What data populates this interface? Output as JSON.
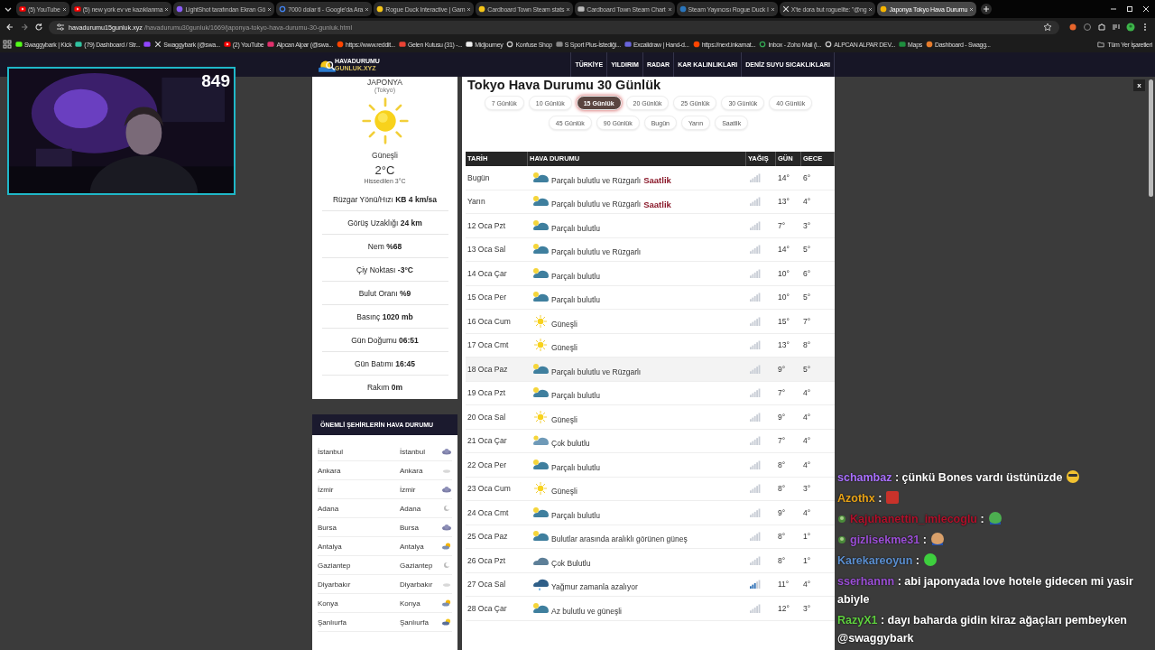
{
  "browser": {
    "tabs": [
      {
        "title": "(5) YouTube",
        "kind": "youtube",
        "selected": false
      },
      {
        "title": "(5) new york ev ve kazıklanma",
        "kind": "youtube",
        "selected": false
      },
      {
        "title": "LightShot tarafından Ekran Gö",
        "kind": "feather",
        "selected": false
      },
      {
        "title": "7000 dolar tl - Google'da Ara",
        "kind": "google",
        "selected": false
      },
      {
        "title": "Rogue Duck Interactive | Gam",
        "kind": "duck",
        "selected": false
      },
      {
        "title": "Cardboard Town Steam stats",
        "kind": "duck",
        "selected": false
      },
      {
        "title": "Cardboard Town Steam Chart",
        "kind": "database",
        "selected": false
      },
      {
        "title": "Steam Yayıncısı Rogue Duck I",
        "kind": "steam",
        "selected": false
      },
      {
        "title": "X'te dora but roguelite: \"@ng",
        "kind": "x",
        "selected": false
      },
      {
        "title": "Japonya Tokyo Hava Durumu",
        "kind": "sun",
        "selected": true
      }
    ],
    "address": {
      "host": "havadurumu15gunluk.xyz",
      "path": "/havadurumu30gunluk/1669/japonya-tokyo-hava-durumu-30-gunluk.html"
    },
    "bookmarks": [
      {
        "label": "Swaggybark | Kick",
        "kind": "kick"
      },
      {
        "label": "(79) Dashboard / Str...",
        "kind": "streamlabs"
      },
      {
        "kind": "twitch"
      },
      {
        "label": "Swaggybark (@swa...",
        "kind": "x"
      },
      {
        "label": "(2) YouTube",
        "kind": "youtube"
      },
      {
        "label": "Alpcan Alpar (@swa...",
        "kind": "instagram"
      },
      {
        "label": "https://www.reddit...",
        "kind": "reddit"
      },
      {
        "label": "Gelen Kutusu (31) -...",
        "kind": "gmail"
      },
      {
        "label": "Midjourney",
        "kind": "page"
      },
      {
        "label": "Konfuse Shop",
        "kind": "globe"
      },
      {
        "label": "S Sport Plus-İstediği...",
        "kind": "sport"
      },
      {
        "label": "Excalidraw | Hand-d...",
        "kind": "excalidraw"
      },
      {
        "label": "https://next.inkarnat...",
        "kind": "reddit"
      },
      {
        "label": "Inbox - Zoho Mail (i...",
        "kind": "chrome"
      },
      {
        "label": "ALPCAN ALPAR DEV...",
        "kind": "globe"
      },
      {
        "label": "Maps",
        "kind": "maps"
      },
      {
        "label": "Dashboard - Swagg...",
        "kind": "dashboard"
      }
    ],
    "all_bookmarks": "Tüm Yer İşaretleri"
  },
  "site": {
    "logo": [
      "HAVADURUMU",
      "GUNLUK.XYZ"
    ],
    "nav": [
      "TÜRKİYE",
      "YILDIRIM",
      "RADAR",
      "KAR KALINLIKLARI",
      "DENİZ SUYU SICAKLIKLARI"
    ]
  },
  "current": {
    "country": "JAPONYA",
    "city": "(Tokyo)",
    "condition": "Güneşli",
    "temperature": "2°C",
    "feels_like": "Hissedilen 3°C",
    "details": [
      "Rüzgar Yönü/Hızı **KB 4 km/sa**",
      "Görüş Uzaklığı **24 km**",
      "Nem **%68**",
      "Çiy Noktası **-3°C**",
      "Bulut Oranı **%9**",
      "Basınç **1020 mb**",
      "Gün Doğumu **06:51**",
      "Gün Batımı **16:45**",
      "Rakım **0m**"
    ]
  },
  "cities": {
    "title": "ÖNEMLİ ŞEHİRLERİN HAVA DURUMU",
    "rows": [
      {
        "left": "İstanbul",
        "right": "İstanbul",
        "kind": "cloud"
      },
      {
        "left": "Ankara",
        "right": "Ankara",
        "kind": "fog"
      },
      {
        "left": "İzmir",
        "right": "İzmir",
        "kind": "cloud"
      },
      {
        "left": "Adana",
        "right": "Adana",
        "kind": "moon"
      },
      {
        "left": "Bursa",
        "right": "Bursa",
        "kind": "cloud"
      },
      {
        "left": "Antalya",
        "right": "Antalya",
        "kind": "sun-cloud"
      },
      {
        "left": "Gaziantep",
        "right": "Gaziantep",
        "kind": "moon"
      },
      {
        "left": "Diyarbakır",
        "right": "Diyarbakır",
        "kind": "fog"
      },
      {
        "left": "Konya",
        "right": "Konya",
        "kind": "sun-cloud"
      },
      {
        "left": "Şanlıurfa",
        "right": "Şanlıurfa",
        "kind": "moon-cloud"
      }
    ]
  },
  "forecast": {
    "title": "Tokyo Hava Durumu 30 Günlük",
    "ranges": [
      {
        "label": "7 Günlük",
        "selected": false
      },
      {
        "label": "10 Günlük",
        "selected": false
      },
      {
        "label": "15 Günlük",
        "selected": true
      },
      {
        "label": "20 Günlük",
        "selected": false
      },
      {
        "label": "25 Günlük",
        "selected": false
      },
      {
        "label": "30 Günlük",
        "selected": false
      },
      {
        "label": "40 Günlük",
        "selected": false
      },
      {
        "label": "45 Günlük",
        "selected": false
      },
      {
        "label": "90 Günlük",
        "selected": false
      },
      {
        "label": "Bugün",
        "selected": false
      },
      {
        "label": "Yarın",
        "selected": false
      },
      {
        "label": "Saatlik",
        "selected": false
      }
    ],
    "columns": [
      "TARİH",
      "HAVA DURUMU",
      "YAĞIŞ",
      "GÜN",
      "GECE"
    ],
    "rows": [
      {
        "date": "Bugün",
        "kind": "partly",
        "description": "Parçalı bulutlu ve Rüzgarlı",
        "link": "Saatlik",
        "rain": false,
        "day": "14°",
        "night": "6°",
        "hovered": false
      },
      {
        "date": "Yarın",
        "kind": "partly",
        "description": "Parçalı bulutlu ve Rüzgarlı",
        "link": "Saatlik",
        "rain": false,
        "day": "13°",
        "night": "4°",
        "hovered": false
      },
      {
        "date": "12 Oca Pzt",
        "kind": "partly",
        "description": "Parçalı bulutlu",
        "rain": false,
        "day": "7°",
        "night": "3°",
        "hovered": false
      },
      {
        "date": "13 Oca Sal",
        "kind": "partly",
        "description": "Parçalı bulutlu ve Rüzgarlı",
        "rain": false,
        "day": "14°",
        "night": "5°",
        "hovered": false
      },
      {
        "date": "14 Oca Çar",
        "kind": "partly",
        "description": "Parçalı bulutlu",
        "rain": false,
        "day": "10°",
        "night": "6°",
        "hovered": false
      },
      {
        "date": "15 Oca Per",
        "kind": "partly",
        "description": "Parçalı bulutlu",
        "rain": false,
        "day": "10°",
        "night": "5°",
        "hovered": false
      },
      {
        "date": "16 Oca Cum",
        "kind": "sun",
        "description": "Güneşli",
        "rain": false,
        "day": "15°",
        "night": "7°",
        "hovered": false
      },
      {
        "date": "17 Oca Cmt",
        "kind": "sun",
        "description": "Güneşli",
        "rain": false,
        "day": "13°",
        "night": "8°",
        "hovered": false
      },
      {
        "date": "18 Oca Paz",
        "kind": "partly",
        "description": "Parçalı bulutlu ve Rüzgarlı",
        "rain": false,
        "day": "9°",
        "night": "5°",
        "hovered": true
      },
      {
        "date": "19 Oca Pzt",
        "kind": "partly",
        "description": "Parçalı bulutlu",
        "rain": false,
        "day": "7°",
        "night": "4°",
        "hovered": false
      },
      {
        "date": "20 Oca Sal",
        "kind": "sun",
        "description": "Güneşli",
        "rain": false,
        "day": "9°",
        "night": "4°",
        "hovered": false
      },
      {
        "date": "21 Oca Çar",
        "kind": "cloudy",
        "description": "Çok bulutlu",
        "rain": false,
        "day": "7°",
        "night": "4°",
        "hovered": false
      },
      {
        "date": "22 Oca Per",
        "kind": "partly",
        "description": "Parçalı bulutlu",
        "rain": false,
        "day": "8°",
        "night": "4°",
        "hovered": false
      },
      {
        "date": "23 Oca Cum",
        "kind": "sun",
        "description": "Güneşli",
        "rain": false,
        "day": "8°",
        "night": "3°",
        "hovered": false
      },
      {
        "date": "24 Oca Cmt",
        "kind": "partly",
        "description": "Parçalı bulutlu",
        "rain": false,
        "day": "9°",
        "night": "4°",
        "hovered": false
      },
      {
        "date": "25 Oca Paz",
        "kind": "partly",
        "description": "Bulutlar arasında aralıklı görünen güneş",
        "rain": false,
        "day": "8°",
        "night": "1°",
        "hovered": false
      },
      {
        "date": "26 Oca Pzt",
        "kind": "overcast",
        "description": "Çok Bulutlu",
        "rain": false,
        "day": "8°",
        "night": "1°",
        "hovered": false
      },
      {
        "date": "27 Oca Sal",
        "kind": "rain",
        "description": "Yağmur zamanla azalıyor",
        "rain": true,
        "day": "11°",
        "night": "4°",
        "hovered": false
      },
      {
        "date": "28 Oca Çar",
        "kind": "partly",
        "description": "Az bulutlu ve güneşli",
        "rain": false,
        "day": "12°",
        "night": "3°",
        "hovered": false
      }
    ]
  },
  "close_label": "x",
  "stream": {
    "viewer_count": "849",
    "chat": [
      {
        "user": "schambaz",
        "color": "#a970ff",
        "text": ": çünkü Bones vardı üstünüzde",
        "badge": false,
        "kind": "smiley"
      },
      {
        "user": "Azothx",
        "color": "#e8a317",
        "text": ":",
        "badge": false,
        "kind": "red"
      },
      {
        "user": "Kajuhanettin_imlecoglu",
        "color": "#b0102a",
        "text": ":",
        "badge": true,
        "kind": "frog"
      },
      {
        "user": "gizlisekme31",
        "color": "#9b4fd6",
        "text": ":",
        "badge": true,
        "kind": "laugh"
      },
      {
        "user": "Karekareoyun",
        "color": "#5b8fd0",
        "text": ":",
        "badge": false,
        "kind": "blob"
      },
      {
        "user": "sserhannn",
        "color": "#9b4fd6",
        "text": ": abi japonyada love hotele gidecen mi yasir abiyle",
        "badge": false
      },
      {
        "user": "RazyX1",
        "color": "#5fd03f",
        "text": ": dayı baharda gidin kiraz ağaçları pembeyken @swaggybark",
        "badge": false
      }
    ]
  }
}
